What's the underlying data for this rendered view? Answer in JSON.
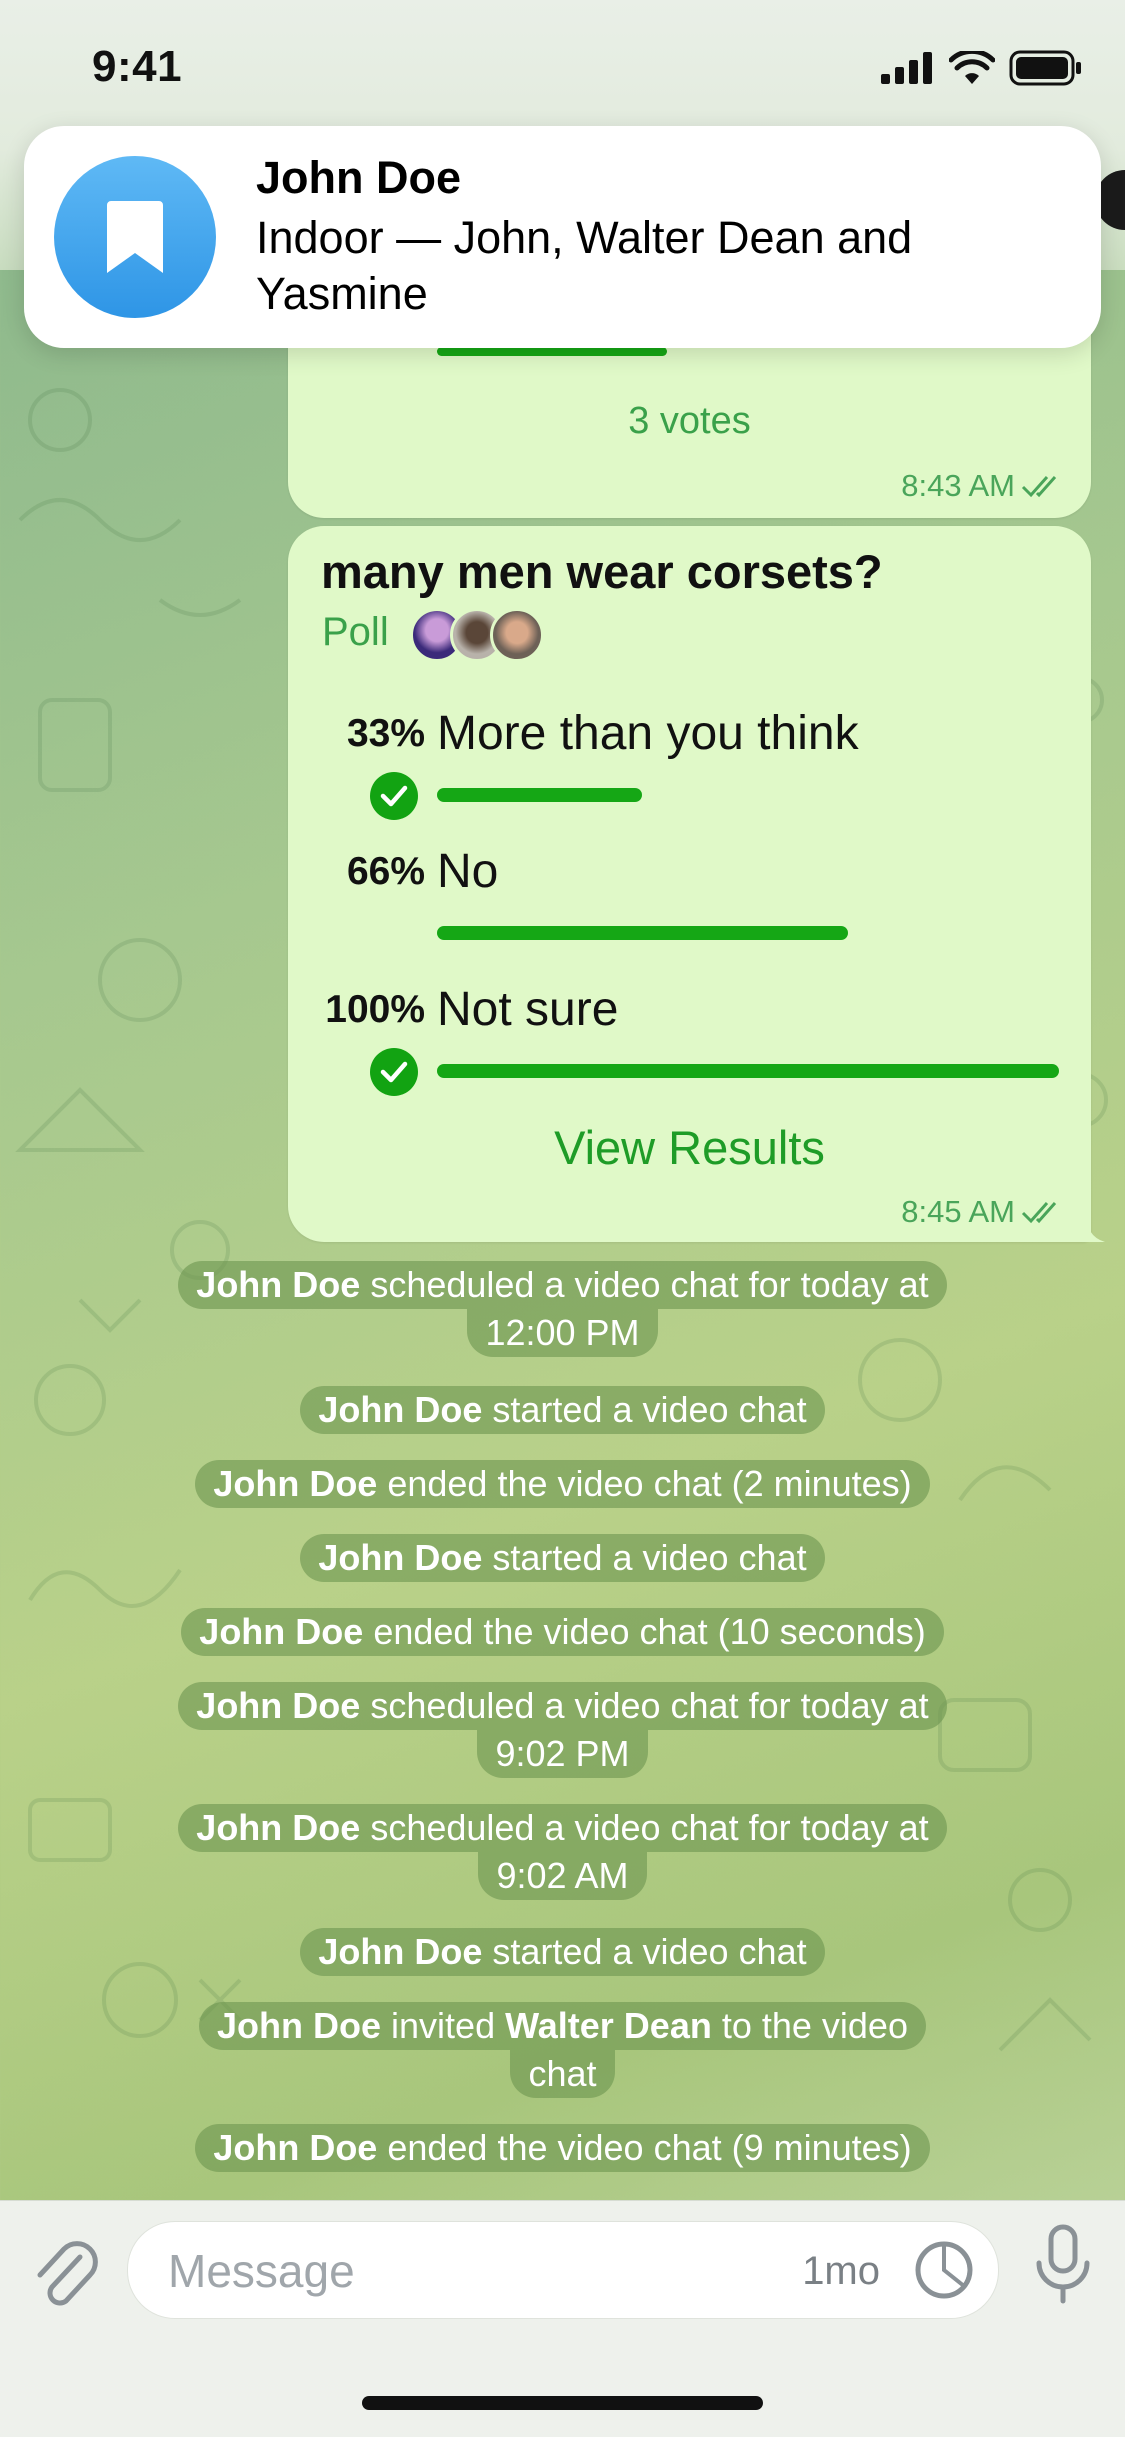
{
  "status_bar": {
    "time": "9:41"
  },
  "notification": {
    "title": "John Doe",
    "body": "Indoor — John, Walter Dean and Yasmine",
    "icon": "bookmark-icon"
  },
  "previous_poll": {
    "votes": "3 votes",
    "time": "8:43 AM"
  },
  "poll": {
    "question": "many men wear corsets?",
    "type": "Poll",
    "options": [
      {
        "percent": "33%",
        "label": "More than you think",
        "fill": 0.33,
        "checked": true
      },
      {
        "percent": "66%",
        "label": "No",
        "fill": 0.66,
        "checked": false
      },
      {
        "percent": "100%",
        "label": "Not sure",
        "fill": 1.0,
        "checked": true
      }
    ],
    "view_results": "View Results",
    "time": "8:45 AM"
  },
  "service_messages": [
    {
      "actor": "John Doe",
      "line1": " scheduled a video chat for today at",
      "line2": "12:00 PM"
    },
    {
      "actor": "John Doe",
      "text": " started a video chat"
    },
    {
      "actor": "John Doe",
      "text": " ended the video chat (2 minutes)"
    },
    {
      "actor": "John Doe",
      "text": " started a video chat"
    },
    {
      "actor": "John Doe",
      "text": " ended the video chat (10 seconds)"
    },
    {
      "actor": "John Doe",
      "line1": " scheduled a video chat for today at",
      "line2": "9:02 PM"
    },
    {
      "actor": "John Doe",
      "line1": " scheduled a video chat for today at",
      "line2": "9:02 AM"
    },
    {
      "actor": "John Doe",
      "text": " started a video chat"
    },
    {
      "actor": "John Doe",
      "mid": " invited ",
      "target": "Walter Dean",
      "line1_end": " to the video",
      "line2": "chat"
    },
    {
      "actor": "John Doe",
      "text": " ended the video chat (9 minutes)"
    }
  ],
  "input": {
    "placeholder": "Message",
    "timer": "1mo"
  }
}
